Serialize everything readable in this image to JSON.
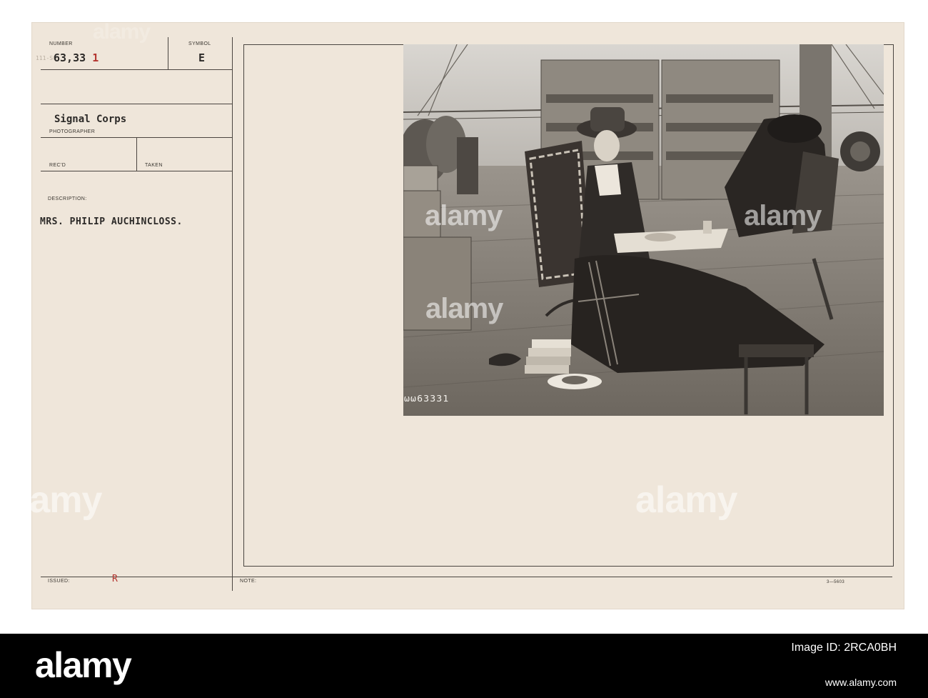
{
  "card": {
    "number_label": "NUMBER",
    "number_value": "63,331",
    "number_prefix": "111-SC",
    "symbol_label": "SYMBOL",
    "symbol_value": "E",
    "photographer_value": "Signal Corps",
    "photographer_label": "PHOTOGRAPHER",
    "recd_label": "REC'D",
    "taken_label": "TAKEN",
    "description_label": "DESCRIPTION:",
    "description_value": "MRS. PHILIP AUCHINCLOSS.",
    "issued_label": "ISSUED:",
    "issued_value": "R",
    "note_label": "NOTE:",
    "form_code": "3—5603"
  },
  "photo": {
    "negative_number": "ωω63331"
  },
  "watermark": {
    "brand": "alamy"
  },
  "footer": {
    "brand": "alamy",
    "image_id": "Image ID: 2RCA0BH",
    "url": "www.alamy.com"
  },
  "colors": {
    "card": "#efe6da",
    "ink": "#2c2a28",
    "red_ink": "#b4352f",
    "footer": "#000000"
  }
}
